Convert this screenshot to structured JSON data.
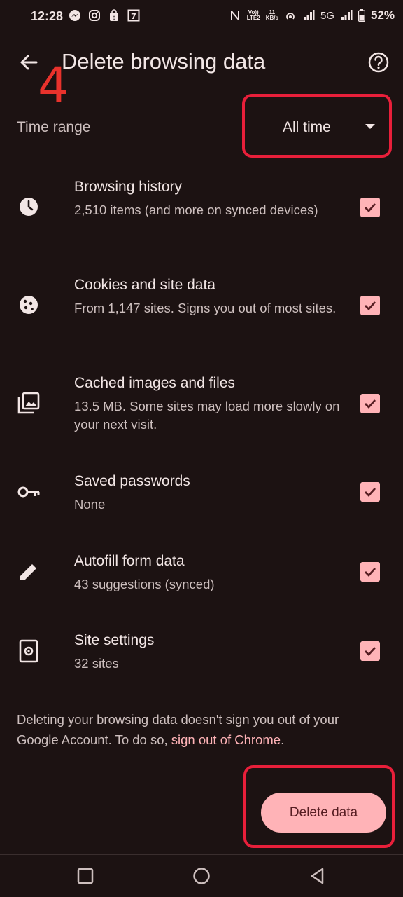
{
  "status_bar": {
    "time": "12:28",
    "left_icons": [
      "messenger-icon",
      "instagram-icon",
      "shopping-bag-icon",
      "calendar-7-icon"
    ],
    "net_label_top": "Vo))",
    "net_label_bottom": "LTE2",
    "speed_top": "11",
    "speed_bottom": "KB/s",
    "network_type": "5G",
    "battery": "52%"
  },
  "header": {
    "title": "Delete browsing data",
    "back_icon": "arrow-left-icon",
    "help_icon": "help-circle-icon"
  },
  "annotation": {
    "step_number": "4",
    "color": "#e81f3a"
  },
  "time_range": {
    "label": "Time range",
    "value": "All time"
  },
  "items": [
    {
      "title": "Browsing history",
      "subtitle": "2,510 items (and more on synced devices)",
      "icon": "history-clock-icon",
      "checked": true
    },
    {
      "title": "Cookies and site data",
      "subtitle": "From 1,147 sites. Signs you out of most sites.",
      "icon": "cookie-icon",
      "checked": true
    },
    {
      "title": "Cached images and files",
      "subtitle": "13.5 MB. Some sites may load more slowly on your next visit.",
      "icon": "images-icon",
      "checked": true
    },
    {
      "title": "Saved passwords",
      "subtitle": "None",
      "icon": "key-icon",
      "checked": true
    },
    {
      "title": "Autofill form data",
      "subtitle": "43 suggestions (synced)",
      "icon": "pencil-icon",
      "checked": true
    },
    {
      "title": "Site settings",
      "subtitle": "32 sites",
      "icon": "site-settings-icon",
      "checked": true
    }
  ],
  "footer": {
    "text": "Deleting your browsing data doesn't sign you out of your Google Account. To do so, ",
    "link": "sign out of Chrome",
    "end": "."
  },
  "delete_button": {
    "label": "Delete data"
  },
  "colors": {
    "background": "#1c1212",
    "accent": "#ffb3b7",
    "annotation": "#e81f3a"
  }
}
